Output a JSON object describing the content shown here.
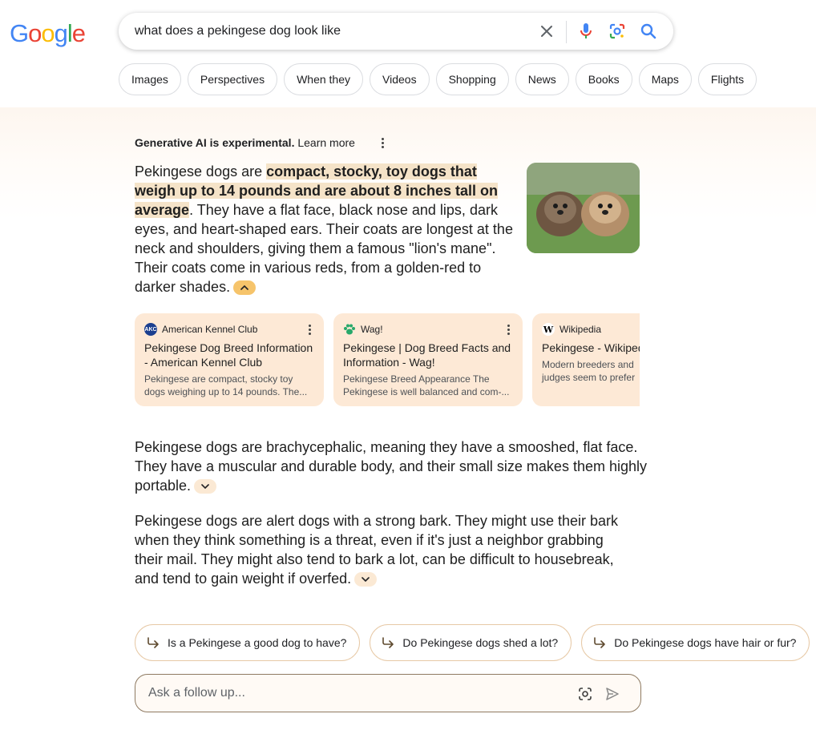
{
  "logo": {
    "letters": [
      "G",
      "o",
      "o",
      "g",
      "l",
      "e"
    ],
    "colors": [
      "#4285F4",
      "#EA4335",
      "#FBBC05",
      "#4285F4",
      "#34A853",
      "#EA4335"
    ]
  },
  "search": {
    "query": "what does a pekingese dog look like"
  },
  "chips": [
    "Images",
    "Perspectives",
    "When they",
    "Videos",
    "Shopping",
    "News",
    "Books",
    "Maps",
    "Flights"
  ],
  "ai": {
    "header_bold": "Generative AI is experimental.",
    "header_link": "Learn more",
    "p1_start": "Pekingese dogs are ",
    "p1_highlight": "compact, stocky, toy dogs that weigh up to 14 pounds and are about 8 inches tall on average",
    "p1_end": ". They have a flat face, black nose and lips, dark eyes, and heart-shaped ears. Their coats are longest at the neck and shoulders, giving them a famous \"lion's mane\". Their coats come in various reds, from a golden-red to darker shades.",
    "sources": [
      {
        "site": "American Kennel Club",
        "favicon": "AKC",
        "title": "Pekingese Dog Breed Information - American Kennel Club",
        "snippet": "Pekingese are compact, stocky toy dogs weighing up to 14 pounds. The..."
      },
      {
        "site": "Wag!",
        "favicon": "paw",
        "title": "Pekingese | Dog Breed Facts and Information - Wag!",
        "snippet": "Pekingese Breed Appearance The Pekingese is well balanced and com-..."
      },
      {
        "site": "Wikipedia",
        "favicon": "W",
        "title": "Pekingese - Wikipedia",
        "snippet": "Modern breeders and judges seem to prefer"
      }
    ],
    "p2": "Pekingese dogs are brachycephalic, meaning they have a smooshed, flat face. They have a muscular and durable body, and their small size makes them highly portable.",
    "p3": "Pekingese dogs are alert dogs with a strong bark. They might use their bark when they think something is a threat, even if it's just a neighbor grabbing their mail. They might also tend to bark a lot, can be difficult to housebreak, and tend to gain weight if overfed.",
    "followups": [
      "Is a Pekingese a good dog to have?",
      "Do Pekingese dogs shed a lot?",
      "Do Pekingese dogs have hair or fur?"
    ],
    "ask_placeholder": "Ask a follow up..."
  }
}
